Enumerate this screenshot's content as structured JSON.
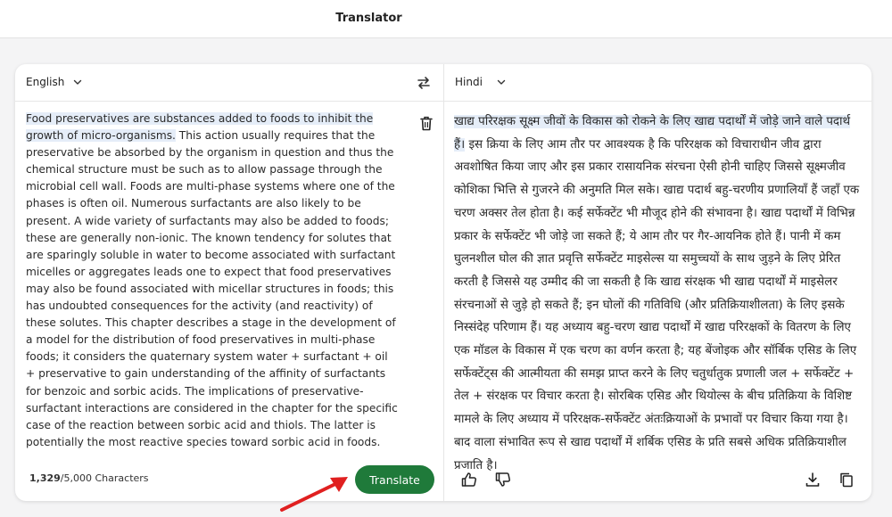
{
  "app": {
    "title": "Translator"
  },
  "source": {
    "language": "English",
    "highlighted_text": "Food preservatives are substances added to foods to inhibit the growth of micro-organisms.",
    "text": " This action usually requires that the preservative be absorbed by the organism in question and thus the chemical structure must be such as to allow passage through the microbial cell wall. Foods are multi-phase systems where one of the phases is often oil. Numerous surfactants are also likely to be present. A wide variety of surfactants may also be added to foods; these are generally non-ionic. The known tendency for solutes that are sparingly soluble in water to become associated with surfactant micelles or aggregates leads one to expect that food preservatives may also be found associated with micellar structures in foods; this has undoubted consequences for the activity (and reactivity) of these solutes. This chapter describes a stage in the development of a model for the distribution of food preservatives in multi-phase foods; it considers the quaternary system water + surfactant + oil + preservative to gain understanding of the affinity of surfactants for benzoic and sorbic acids. The implications of preservative-surfactant interactions are considered in the chapter for the specific case of the reaction between sorbic acid and thiols. The latter is potentially the most reactive species toward sorbic acid in foods.",
    "char_count": "1,329",
    "char_limit": "/5,000 Characters"
  },
  "target": {
    "language": "Hindi",
    "highlighted_text": "खाद्य परिरक्षक सूक्ष्म जीवों के विकास को रोकने के लिए खाद्य पदार्थों में जोड़े जाने वाले पदार्थ हैं।",
    "text": " इस क्रिया के लिए आम तौर पर आवश्यक है कि परिरक्षक को विचाराधीन जीव द्वारा अवशोषित किया जाए और इस प्रकार रासायनिक संरचना ऐसी होनी चाहिए जिससे सूक्ष्मजीव कोशिका भित्ति से गुजरने की अनुमति मिल सके। खाद्य पदार्थ बहु-चरणीय प्रणालियाँ हैं जहाँ एक चरण अक्सर तेल होता है। कई सर्फेक्टेंट भी मौजूद होने की संभावना है। खाद्य पदार्थों में विभिन्न प्रकार के सर्फेक्टेंट भी जोड़े जा सकते हैं; ये आम तौर पर गैर-आयनिक होते हैं। पानी में कम घुलनशील घोल की ज्ञात प्रवृत्ति सर्फेक्टेंट माइसेल्स या समुच्चयों के साथ जुड़ने के लिए प्रेरित करती है जिससे यह उम्मीद की जा सकती है कि खाद्य संरक्षक भी खाद्य पदार्थों में माइसेलर संरचनाओं से जुड़े हो सकते हैं; इन घोलों की गतिविधि (और प्रतिक्रियाशीलता) के लिए इसके निस्संदेह परिणाम हैं। यह अध्याय बहु-चरण खाद्य पदार्थों में खाद्य परिरक्षकों के वितरण के लिए एक मॉडल के विकास में एक चरण का वर्णन करता है; यह बेंजोइक और सॉर्बिक एसिड के लिए सर्फेक्टेंट्स की आत्मीयता की समझ प्राप्त करने के लिए चतुर्धातुक प्रणाली जल + सर्फेक्टेंट + तेल + संरक्षक पर विचार करता है। सोरबिक एसिड और थियोल्स के बीच प्रतिक्रिया के विशिष्ट मामले के लिए अध्याय में परिरक्षक-सर्फेक्टेंट अंतःक्रियाओं के प्रभावों पर विचार किया गया है। बाद वाला संभावित रूप से खाद्य पदार्थों में शर्बिक एसिड के प्रति सबसे अधिक प्रतिक्रियाशील प्रजाति है।"
  },
  "actions": {
    "translate_label": "Translate"
  },
  "icons": {
    "swap": "swap-arrows-icon",
    "trash": "trash-icon",
    "like": "thumbs-up-icon",
    "dislike": "thumbs-down-icon",
    "download": "download-icon",
    "copy": "copy-icon",
    "pointer": "red-arrow-icon"
  },
  "colors": {
    "accent": "#1f7a3a",
    "highlight": "#e5edf8",
    "annotation": "#e02020"
  }
}
